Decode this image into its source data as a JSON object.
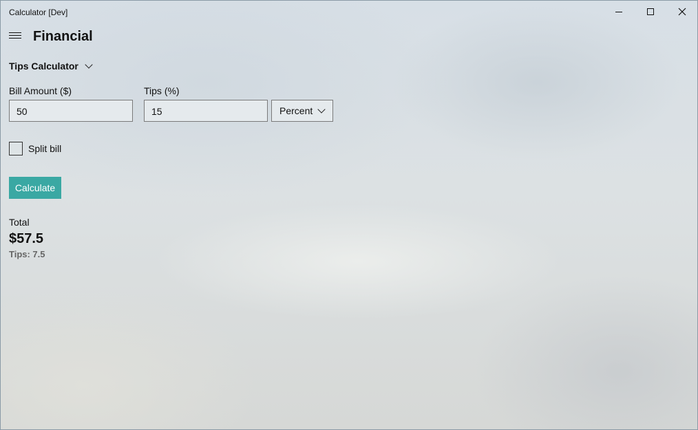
{
  "window": {
    "title": "Calculator [Dev]",
    "controls": [
      "minimize",
      "maximize",
      "close"
    ]
  },
  "header": {
    "title": "Financial",
    "menu_icon": "hamburger-icon"
  },
  "mode": {
    "selected": "Tips Calculator"
  },
  "form": {
    "bill_amount_label": "Bill Amount ($)",
    "bill_amount_value": "50",
    "tips_label": "Tips (%)",
    "tips_value": "15",
    "tips_unit_selected": "Percent",
    "split_bill_label": "Split bill",
    "split_bill_checked": false,
    "calculate_label": "Calculate"
  },
  "result": {
    "total_label": "Total",
    "total_value": "$57.5",
    "tips_line": "Tips: 7.5"
  },
  "colors": {
    "accent": "#3aa8a3",
    "secondary_text": "#666666"
  }
}
